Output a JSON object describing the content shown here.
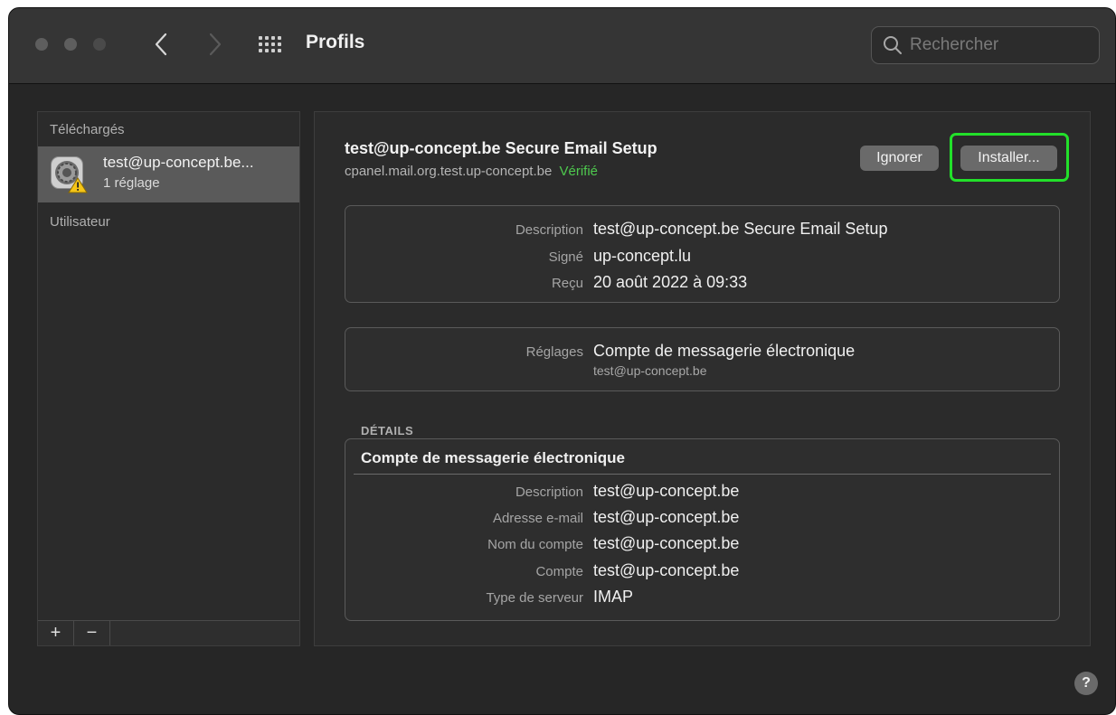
{
  "window": {
    "title": "Profils",
    "search_placeholder": "Rechercher"
  },
  "sidebar": {
    "section_downloaded": "Téléchargés",
    "profile": {
      "name": "test@up-concept.be...",
      "subtitle": "1 réglage"
    },
    "section_user": "Utilisateur",
    "add_label": "+",
    "remove_label": "−"
  },
  "profile": {
    "title": "test@up-concept.be Secure Email Setup",
    "identifier": "cpanel.mail.org.test.up-concept.be",
    "verified": "Vérifié",
    "ignore_button": "Ignorer",
    "install_button": "Installer...",
    "summary": [
      {
        "key": "Description",
        "value": "test@up-concept.be Secure Email Setup"
      },
      {
        "key": "Signé",
        "value": "up-concept.lu"
      },
      {
        "key": "Reçu",
        "value": "20 août 2022 à 09:33"
      }
    ],
    "settings": {
      "key": "Réglages",
      "value": "Compte de messagerie électronique",
      "sub": "test@up-concept.be"
    },
    "details_label": "DÉTAILS",
    "details": {
      "title": "Compte de messagerie électronique",
      "rows": [
        {
          "key": "Description",
          "value": "test@up-concept.be"
        },
        {
          "key": "Adresse e-mail",
          "value": "test@up-concept.be"
        },
        {
          "key": "Nom du compte",
          "value": "test@up-concept.be"
        },
        {
          "key": "Compte",
          "value": "test@up-concept.be"
        },
        {
          "key": "Type de serveur",
          "value": "IMAP"
        }
      ]
    }
  },
  "help_label": "?",
  "colors": {
    "verified": "#4ec94e",
    "highlight": "#22e02a",
    "window_bg": "#262626"
  }
}
